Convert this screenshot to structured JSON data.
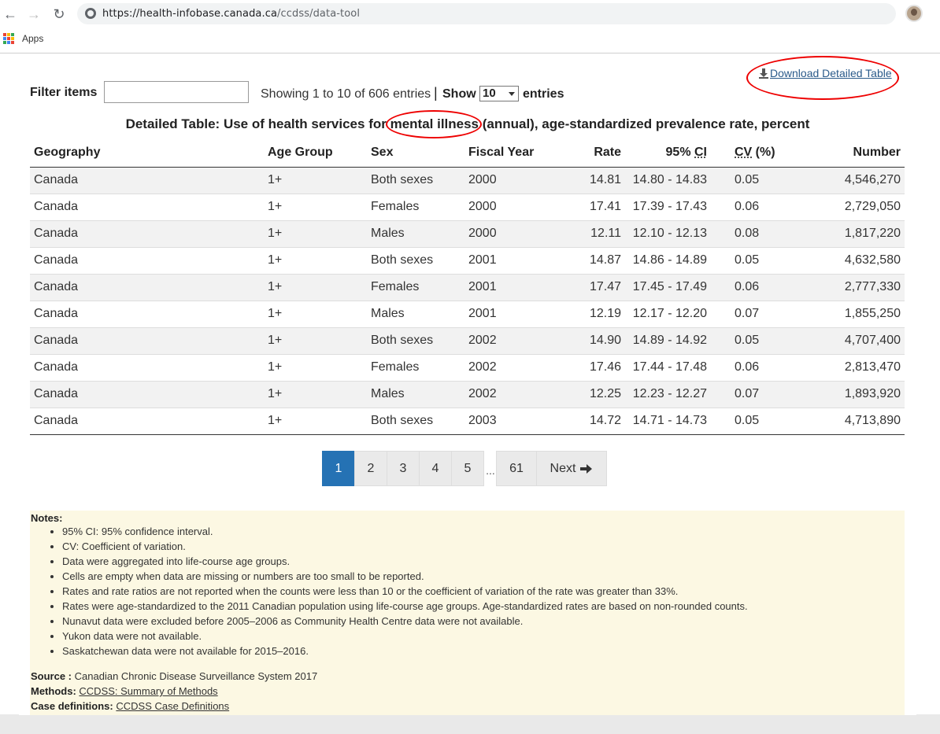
{
  "browser": {
    "url_host": "https://health-infobase.canada.ca",
    "url_path": "/ccdss/data-tool",
    "bookmark_apps": "Apps",
    "apps_colors": [
      "#ea4335",
      "#fbbc05",
      "#34a853",
      "#4285f4",
      "#ea4335",
      "#fbbc05",
      "#34a853",
      "#4285f4",
      "#ea4335"
    ]
  },
  "toolbar": {
    "download_label": "Download Detailed Table",
    "filter_label": "Filter items",
    "filter_value": "",
    "showing_text": "Showing 1 to 10 of 606 entries",
    "separator": "|",
    "show_label": "Show",
    "show_value": "10",
    "entries_label": "entries"
  },
  "table": {
    "title": "Detailed Table: Use of health services for mental illness (annual), age-standardized prevalence rate, percent",
    "headers": {
      "geography": "Geography",
      "age_group": "Age Group",
      "sex": "Sex",
      "fiscal_year": "Fiscal Year",
      "rate": "Rate",
      "ci_prefix": "95% ",
      "ci_abbr": "CI",
      "cv_abbr": "CV",
      "cv_suffix": " (%)",
      "number": "Number"
    },
    "rows": [
      [
        "Canada",
        "1+",
        "Both sexes",
        "2000",
        "14.81",
        "14.80 - 14.83",
        "0.05",
        "4,546,270"
      ],
      [
        "Canada",
        "1+",
        "Females",
        "2000",
        "17.41",
        "17.39 - 17.43",
        "0.06",
        "2,729,050"
      ],
      [
        "Canada",
        "1+",
        "Males",
        "2000",
        "12.11",
        "12.10 - 12.13",
        "0.08",
        "1,817,220"
      ],
      [
        "Canada",
        "1+",
        "Both sexes",
        "2001",
        "14.87",
        "14.86 - 14.89",
        "0.05",
        "4,632,580"
      ],
      [
        "Canada",
        "1+",
        "Females",
        "2001",
        "17.47",
        "17.45 - 17.49",
        "0.06",
        "2,777,330"
      ],
      [
        "Canada",
        "1+",
        "Males",
        "2001",
        "12.19",
        "12.17 - 12.20",
        "0.07",
        "1,855,250"
      ],
      [
        "Canada",
        "1+",
        "Both sexes",
        "2002",
        "14.90",
        "14.89 - 14.92",
        "0.05",
        "4,707,400"
      ],
      [
        "Canada",
        "1+",
        "Females",
        "2002",
        "17.46",
        "17.44 - 17.48",
        "0.06",
        "2,813,470"
      ],
      [
        "Canada",
        "1+",
        "Males",
        "2002",
        "12.25",
        "12.23 - 12.27",
        "0.07",
        "1,893,920"
      ],
      [
        "Canada",
        "1+",
        "Both sexes",
        "2003",
        "14.72",
        "14.71 - 14.73",
        "0.05",
        "4,713,890"
      ]
    ]
  },
  "pagination": {
    "pages": [
      "1",
      "2",
      "3",
      "4",
      "5"
    ],
    "ellipsis": "...",
    "last": "61",
    "next": "Next",
    "active": "1"
  },
  "notes": {
    "heading": "Notes:",
    "items": [
      "95% CI: 95% confidence interval.",
      "CV: Coefficient of variation.",
      "Data were aggregated into life-course age groups.",
      "Cells are empty when data are missing or numbers are too small to be reported.",
      "Rates and rate ratios are not reported when the counts were less than 10 or the coefficient of variation of the rate was greater than 33%.",
      "Rates were age-standardized to the 2011 Canadian population using life-course age groups. Age-standardized rates are based on non-rounded counts.",
      "Nunavut data were excluded before 2005–2006 as Community Health Centre data were not available.",
      "Yukon data were not available.",
      "Saskatchewan data were not available for 2015–2016."
    ],
    "source_label": "Source :",
    "source_text": "Canadian Chronic Disease Surveillance System 2017",
    "methods_label": "Methods:",
    "methods_link": "CCDSS: Summary of Methods",
    "case_label": "Case definitions:",
    "case_link": "CCDSS Case Definitions"
  },
  "colors": {
    "accent": "#2572b4",
    "notes_bg": "#fcf8e3",
    "annotation": "#ee0000"
  }
}
